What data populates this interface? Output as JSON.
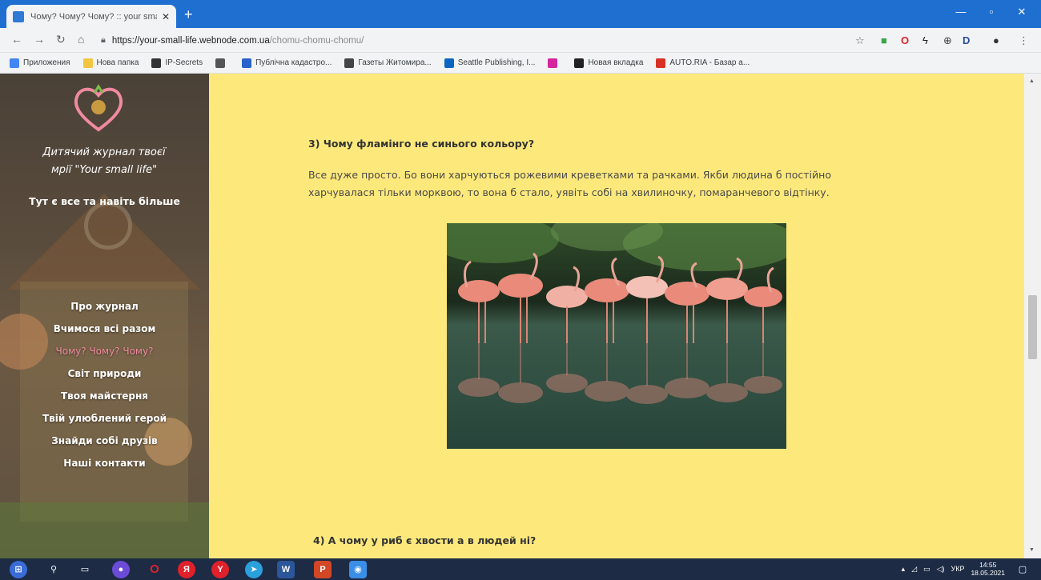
{
  "browser": {
    "tab_title": "Чому? Чому? Чому? :: your sma",
    "tab_close": "✕",
    "new_tab": "+",
    "url_host": "https://your-small-life.webnode.com.ua",
    "url_path": "/chomu-chomu-chomu/",
    "bookmarks": [
      {
        "label": "Приложения",
        "icon": "apps-icon",
        "color": "#4285f4"
      },
      {
        "label": "Нова папка",
        "icon": "folder-icon",
        "color": "#f4c542"
      },
      {
        "label": "IP-Secrets",
        "icon": "ip-icon",
        "color": "#333333"
      },
      {
        "label": "",
        "icon": "globe-icon",
        "color": "#555555"
      },
      {
        "label": "Публічна кадастро...",
        "icon": "map-icon",
        "color": "#2a62c9"
      },
      {
        "label": "Газеты Житомира...",
        "icon": "newspaper-icon",
        "color": "#444444"
      },
      {
        "label": "Seattle Publishing, I...",
        "icon": "linkedin-icon",
        "color": "#0a66c2"
      },
      {
        "label": "",
        "icon": "instagram-icon",
        "color": "#d6249f"
      },
      {
        "label": "Новая вкладка",
        "icon": "flash-icon",
        "color": "#222222"
      },
      {
        "label": "AUTO.RIA - Базар а...",
        "icon": "car-icon",
        "color": "#d93025"
      }
    ]
  },
  "sidebar": {
    "magazine_title_line1": "Дитячий журнал твоєї",
    "magazine_title_line2": "мрії \"Your small life\"",
    "tagline": "Тут є все та навіть більше",
    "menu": [
      {
        "label": "Про журнал",
        "active": false
      },
      {
        "label": "Вчимося всі разом",
        "active": false
      },
      {
        "label": "Чому? Чому? Чому?",
        "active": true
      },
      {
        "label": "Світ природи",
        "active": false
      },
      {
        "label": "Твоя майстерня",
        "active": false
      },
      {
        "label": "Твій улюблений герой",
        "active": false
      },
      {
        "label": "Знайди собі друзів",
        "active": false
      },
      {
        "label": "Наші контакти",
        "active": false
      }
    ]
  },
  "content": {
    "question3": "3) Чому фламінго не синього кольору?",
    "answer3": "Все дуже просто. Бо вони харчуються рожевими креветками та рачками. Якби людина б постійно харчувалася тільки морквою, то вона б стало, уявіть собі на хвилиночку, помаранчевого відтінку.",
    "question4": "4)  А чому у риб є хвости а в людей ні?"
  },
  "taskbar": {
    "language": "УКР",
    "time": "14:55",
    "date": "18.05.2021"
  }
}
